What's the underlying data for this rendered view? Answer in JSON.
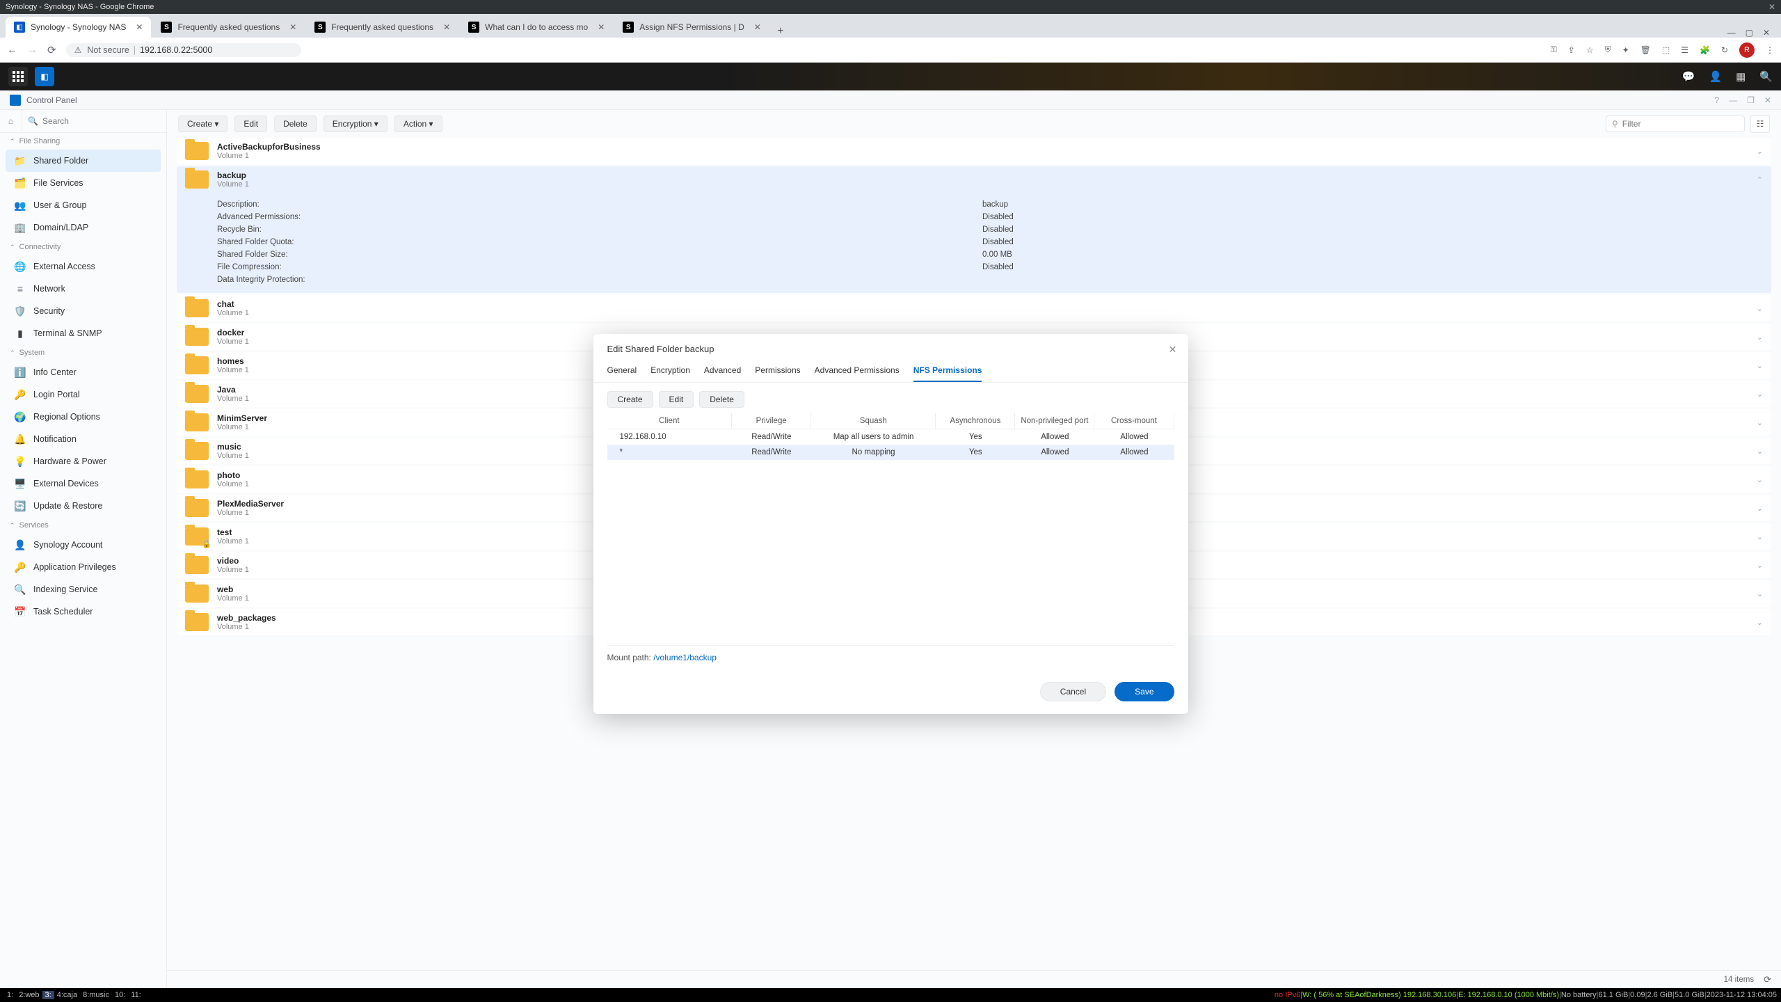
{
  "os": {
    "title": "Synology - Synology NAS - Google Chrome",
    "bar": {
      "ws": [
        "1:",
        "2:web",
        "3:",
        "4:caja",
        "8:music",
        "10:",
        "11:"
      ],
      "active_ws": "3:",
      "no_ipv6": "no IPv6",
      "w": "W: (  56% at SEAofDarkness) 192.168.30.106",
      "e": "E: 192.168.0.10 (1000 Mbit/s)",
      "bat": "No battery",
      "mem": "61.1 GiB",
      "load": "0.09",
      "disk": "2.6 GiB",
      "temp": "51.0 GiB",
      "date": "2023-11-12 13:04:05"
    }
  },
  "tabs": [
    {
      "label": "Synology - Synology NAS",
      "type": "syn",
      "active": true
    },
    {
      "label": "Frequently asked questions",
      "type": "s"
    },
    {
      "label": "Frequently asked questions",
      "type": "s"
    },
    {
      "label": "What can I do to access mo",
      "type": "s"
    },
    {
      "label": "Assign NFS Permissions | D",
      "type": "s"
    }
  ],
  "addr": {
    "not_secure": "Not secure",
    "url": "192.168.0.22:5000"
  },
  "cp_title": "Control Panel",
  "side": {
    "search_ph": "Search",
    "groups": [
      {
        "label": "File Sharing",
        "items": [
          {
            "label": "Shared Folder",
            "icon": "📁",
            "color": "#f6b93b",
            "active": true
          },
          {
            "label": "File Services",
            "icon": "🗂️",
            "color": "#0a79d0"
          },
          {
            "label": "User & Group",
            "icon": "👥",
            "color": "#0a79d0"
          },
          {
            "label": "Domain/LDAP",
            "icon": "🏢",
            "color": "#0a79d0"
          }
        ]
      },
      {
        "label": "Connectivity",
        "items": [
          {
            "label": "External Access",
            "icon": "🌐",
            "color": "#0a79d0"
          },
          {
            "label": "Network",
            "icon": "≡",
            "color": "#607080"
          },
          {
            "label": "Security",
            "icon": "🛡️",
            "color": "#2a9d5a"
          },
          {
            "label": "Terminal & SNMP",
            "icon": "▮",
            "color": "#3a4048"
          }
        ]
      },
      {
        "label": "System",
        "items": [
          {
            "label": "Info Center",
            "icon": "ℹ️",
            "color": "#0a79d0"
          },
          {
            "label": "Login Portal",
            "icon": "🔑",
            "color": "#444"
          },
          {
            "label": "Regional Options",
            "icon": "🌍",
            "color": "#2a9d5a"
          },
          {
            "label": "Notification",
            "icon": "🔔",
            "color": "#f6b93b"
          },
          {
            "label": "Hardware & Power",
            "icon": "💡",
            "color": "#f6b93b"
          },
          {
            "label": "External Devices",
            "icon": "🖥️",
            "color": "#445"
          },
          {
            "label": "Update & Restore",
            "icon": "🔄",
            "color": "#3a7"
          }
        ]
      },
      {
        "label": "Services",
        "items": [
          {
            "label": "Synology Account",
            "icon": "👤",
            "color": "#0a79d0"
          },
          {
            "label": "Application Privileges",
            "icon": "🔑",
            "color": "#888"
          },
          {
            "label": "Indexing Service",
            "icon": "🔍",
            "color": "#0a79d0"
          },
          {
            "label": "Task Scheduler",
            "icon": "📅",
            "color": "#d33"
          }
        ]
      }
    ]
  },
  "toolbar": {
    "create": "Create",
    "edit": "Edit",
    "delete": "Delete",
    "encryption": "Encryption",
    "action": "Action",
    "filter_ph": "Filter"
  },
  "folders": [
    {
      "name": "ActiveBackupforBusiness",
      "vol": "Volume 1"
    },
    {
      "name": "backup",
      "vol": "Volume 1",
      "expanded": true,
      "details": [
        {
          "k": "Description:",
          "v": "backup"
        },
        {
          "k": "Advanced Permissions:",
          "v": "Disabled"
        },
        {
          "k": "Recycle Bin:",
          "v": "Disabled"
        },
        {
          "k": "Shared Folder Quota:",
          "v": "Disabled"
        },
        {
          "k": "Shared Folder Size:",
          "v": "0.00 MB"
        },
        {
          "k": "File Compression:",
          "v": "Disabled"
        },
        {
          "k": "Data Integrity Protection:",
          "v": ""
        }
      ]
    },
    {
      "name": "chat",
      "vol": "Volume 1"
    },
    {
      "name": "docker",
      "vol": "Volume 1"
    },
    {
      "name": "homes",
      "vol": "Volume 1"
    },
    {
      "name": "Java",
      "vol": "Volume 1"
    },
    {
      "name": "MinimServer",
      "vol": "Volume 1"
    },
    {
      "name": "music",
      "vol": "Volume 1"
    },
    {
      "name": "photo",
      "vol": "Volume 1"
    },
    {
      "name": "PlexMediaServer",
      "vol": "Volume 1"
    },
    {
      "name": "test",
      "vol": "Volume 1",
      "locked": true
    },
    {
      "name": "video",
      "vol": "Volume 1"
    },
    {
      "name": "web",
      "vol": "Volume 1"
    },
    {
      "name": "web_packages",
      "vol": "Volume 1"
    }
  ],
  "status": {
    "count": "14 items"
  },
  "modal": {
    "title": "Edit Shared Folder backup",
    "tabs": [
      "General",
      "Encryption",
      "Advanced",
      "Permissions",
      "Advanced Permissions",
      "NFS Permissions"
    ],
    "active_tab": "NFS Permissions",
    "btns": {
      "create": "Create",
      "edit": "Edit",
      "delete": "Delete"
    },
    "cols": [
      "Client",
      "Privilege",
      "Squash",
      "Asynchronous",
      "Non-privileged port",
      "Cross-mount"
    ],
    "rows": [
      {
        "c": [
          "192.168.0.10",
          "Read/Write",
          "Map all users to admin",
          "Yes",
          "Allowed",
          "Allowed"
        ],
        "sel": false
      },
      {
        "c": [
          "*",
          "Read/Write",
          "No mapping",
          "Yes",
          "Allowed",
          "Allowed"
        ],
        "sel": true
      }
    ],
    "mount_label": "Mount path: ",
    "mount_path": "/volume1/backup",
    "cancel": "Cancel",
    "save": "Save"
  }
}
